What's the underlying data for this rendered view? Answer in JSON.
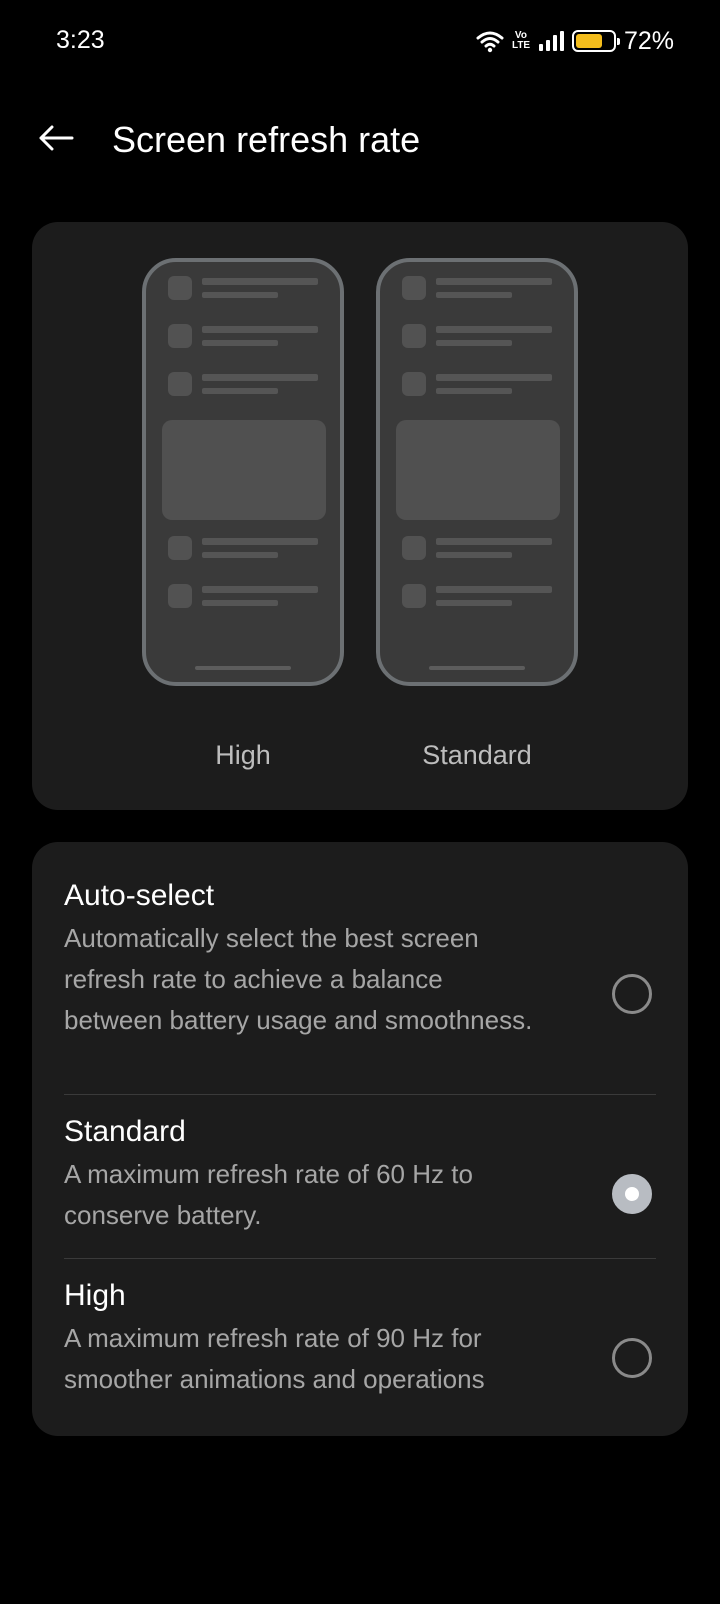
{
  "status_bar": {
    "time": "3:23",
    "network_badge_top": "Vo",
    "network_badge_bottom": "LTE",
    "battery_percent": "72%",
    "battery_level": 0.72,
    "battery_color": "#f4bd1c"
  },
  "header": {
    "back_icon": "arrow-left-icon",
    "title": "Screen refresh rate"
  },
  "preview": {
    "labels": [
      "High",
      "Standard"
    ]
  },
  "options": [
    {
      "title": "Auto-select",
      "description": "Automatically select the best screen refresh rate to achieve a balance between battery usage and smoothness.",
      "selected": false
    },
    {
      "title": "Standard",
      "description": "A maximum refresh rate of 60 Hz to conserve battery.",
      "selected": true
    },
    {
      "title": "High",
      "description": "A maximum refresh rate of 90 Hz for smoother animations and operations",
      "selected": false
    }
  ]
}
